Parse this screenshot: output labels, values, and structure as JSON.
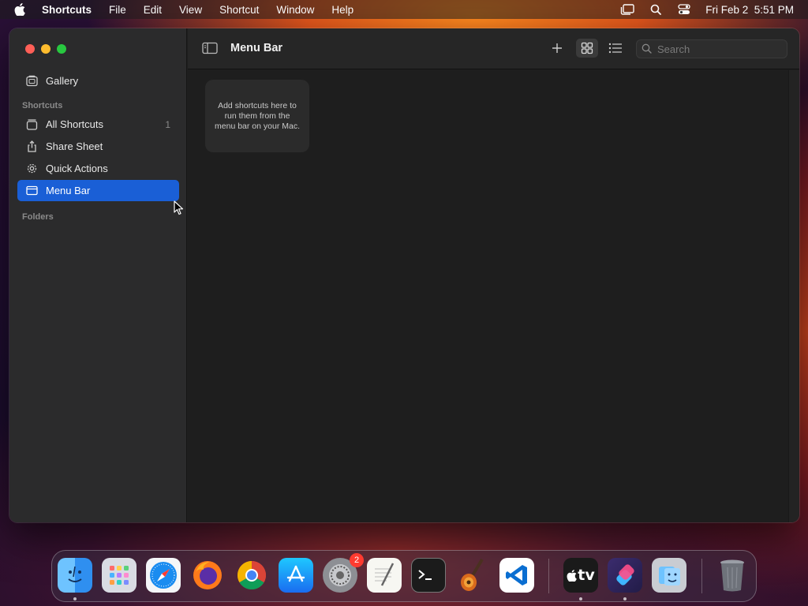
{
  "menubar": {
    "app_name": "Shortcuts",
    "items": [
      "File",
      "Edit",
      "View",
      "Shortcut",
      "Window",
      "Help"
    ],
    "datetime": "Fri Feb 2  5:51 PM",
    "status_icons": [
      "stage-manager-icon",
      "spotlight-search-icon",
      "control-center-icon"
    ]
  },
  "sidebar": {
    "gallery_label": "Gallery",
    "shortcuts_heading": "Shortcuts",
    "items": [
      {
        "label": "All Shortcuts",
        "count": "1",
        "icon": "stack-icon"
      },
      {
        "label": "Share Sheet",
        "icon": "share-icon"
      },
      {
        "label": "Quick Actions",
        "icon": "gear-icon"
      },
      {
        "label": "Menu Bar",
        "icon": "menu-bar-icon",
        "selected": true
      }
    ],
    "folders_heading": "Folders"
  },
  "toolbar": {
    "title": "Menu Bar",
    "search_placeholder": "Search",
    "search_value": ""
  },
  "content": {
    "empty_card_text": "Add shortcuts here to run them from the menu bar on your Mac."
  },
  "dock": {
    "apps": [
      "Finder",
      "Launchpad",
      "Safari",
      "Firefox",
      "Chrome",
      "App Store",
      "System Settings",
      "TextEdit",
      "Terminal",
      "GarageBand",
      "Visual Studio Code",
      "TV",
      "Shortcuts",
      "Migration Assistant",
      "Trash"
    ],
    "system_settings_badge": "2",
    "tv_label": "tv"
  },
  "colors": {
    "selection": "#1a5fd6",
    "close": "#ff5f57",
    "minimize": "#febc2e",
    "maximize": "#28c840"
  }
}
